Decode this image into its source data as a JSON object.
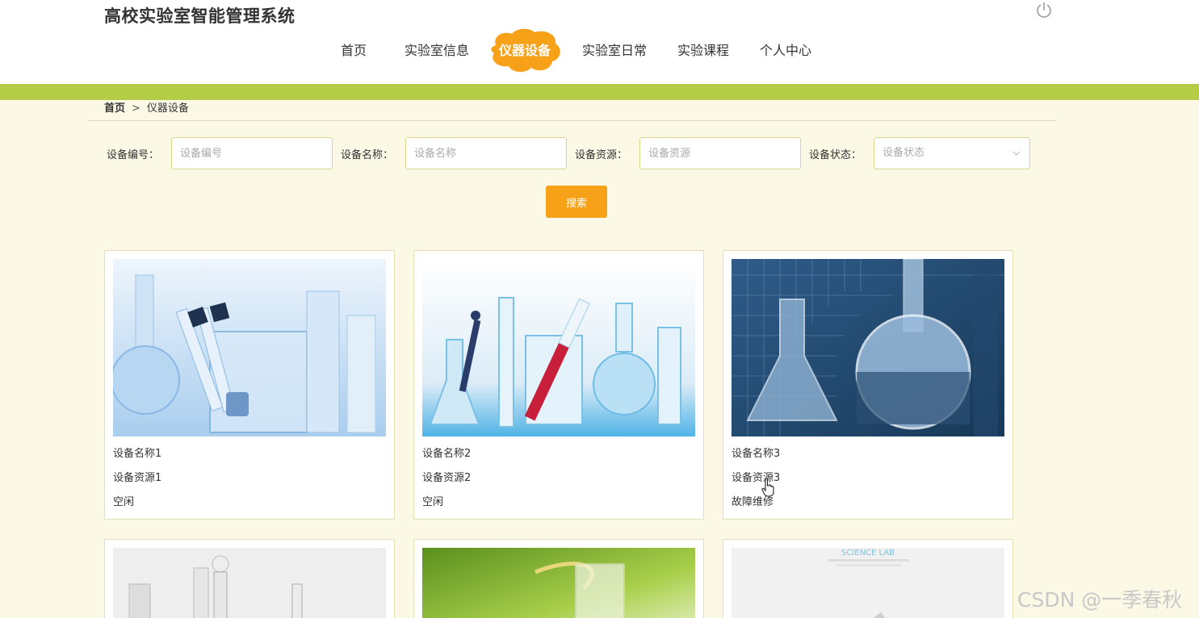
{
  "header": {
    "site_title": "高校实验室智能管理系统"
  },
  "nav": {
    "items": [
      {
        "label": "首页"
      },
      {
        "label": "实验室信息"
      },
      {
        "label": "仪器设备"
      },
      {
        "label": "实验室日常"
      },
      {
        "label": "实验课程"
      },
      {
        "label": "个人中心"
      }
    ],
    "active_index": 2
  },
  "breadcrumb": {
    "home": "首页",
    "separator": ">",
    "current": "仪器设备"
  },
  "filters": {
    "device_no": {
      "label": "设备编号：",
      "placeholder": "设备编号",
      "value": ""
    },
    "device_name": {
      "label": "设备名称：",
      "placeholder": "设备名称",
      "value": ""
    },
    "device_resource": {
      "label": "设备资源：",
      "placeholder": "设备资源",
      "value": ""
    },
    "device_status": {
      "label": "设备状态：",
      "placeholder": "设备状态",
      "value": ""
    },
    "search_label": "搜索"
  },
  "devices": [
    {
      "name": "设备名称1",
      "resource": "设备资源1",
      "status": "空闲"
    },
    {
      "name": "设备名称2",
      "resource": "设备资源2",
      "status": "空闲"
    },
    {
      "name": "设备名称3",
      "resource": "设备资源3",
      "status": "故障维修"
    },
    {
      "name": "",
      "resource": "",
      "status": ""
    },
    {
      "name": "",
      "resource": "",
      "status": ""
    },
    {
      "name": "",
      "resource": "",
      "status": ""
    }
  ],
  "card6_image_text": "SCIENCE LAB",
  "watermark": "CSDN @一季春秋",
  "colors": {
    "accent": "#f7a118",
    "band": "#b5cc47",
    "background": "#fbf8e6",
    "input_border": "#d9d68d"
  }
}
